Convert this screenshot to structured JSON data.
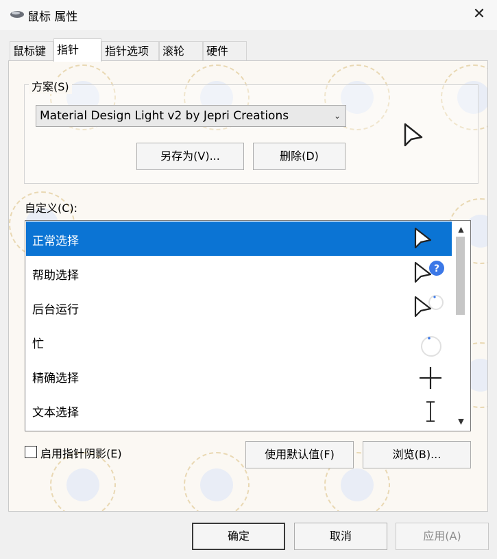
{
  "window": {
    "title": "鼠标 属性",
    "icon": "mouse-icon",
    "close": "✕"
  },
  "tabs": [
    {
      "label": "鼠标键"
    },
    {
      "label": "指针",
      "active": true
    },
    {
      "label": "指针选项"
    },
    {
      "label": "滚轮"
    },
    {
      "label": "硬件"
    }
  ],
  "scheme": {
    "group_label": "方案(S)",
    "selected": "Material Design Light v2 by Jepri Creations",
    "save_as_label": "另存为(V)...",
    "delete_label": "删除(D)"
  },
  "customize": {
    "label": "自定义(C):",
    "items": [
      {
        "label": "正常选择",
        "icon": "arrow-cursor-icon",
        "selected": true
      },
      {
        "label": "帮助选择",
        "icon": "help-cursor-icon"
      },
      {
        "label": "后台运行",
        "icon": "working-in-background-cursor-icon"
      },
      {
        "label": "忙",
        "icon": "busy-cursor-icon"
      },
      {
        "label": "精确选择",
        "icon": "crosshair-cursor-icon"
      },
      {
        "label": "文本选择",
        "icon": "text-beam-cursor-icon"
      }
    ]
  },
  "options": {
    "shadow_label": "启用指针阴影(E)",
    "shadow_checked": false,
    "use_default_label": "使用默认值(F)",
    "browse_label": "浏览(B)..."
  },
  "footer": {
    "ok_label": "确定",
    "cancel_label": "取消",
    "apply_label": "应用(A)"
  },
  "colors": {
    "selection": "#0b74d4",
    "help_badge": "#3b78e7"
  }
}
